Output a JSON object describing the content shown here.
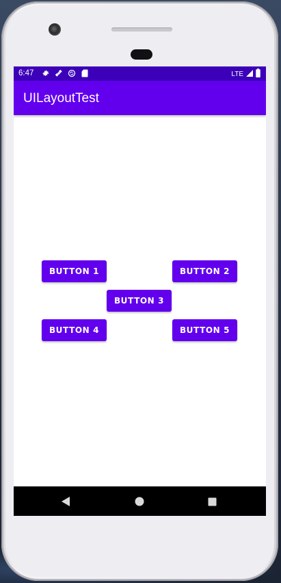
{
  "status_bar": {
    "time": "6:47",
    "network": "LTE",
    "icons_left": [
      "settings-icon",
      "satellite-icon",
      "sync-icon",
      "sd-card-icon"
    ],
    "icons_right": [
      "signal-icon",
      "battery-icon"
    ],
    "color": "#3b00b8"
  },
  "app_bar": {
    "title": "UILayoutTest",
    "color": "#6200ee"
  },
  "buttons": [
    {
      "label": "BUTTON 1"
    },
    {
      "label": "BUTTON 2"
    },
    {
      "label": "BUTTON 3"
    },
    {
      "label": "BUTTON 4"
    },
    {
      "label": "BUTTON 5"
    }
  ],
  "nav_bar": {
    "items": [
      "back-icon",
      "home-icon",
      "recents-icon"
    ]
  }
}
